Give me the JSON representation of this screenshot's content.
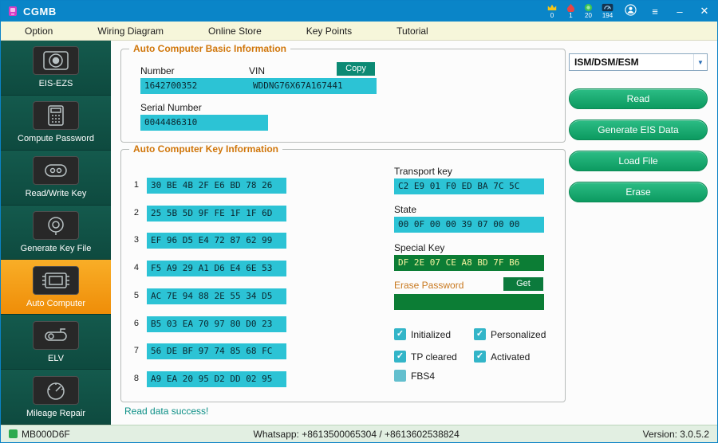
{
  "colors": {
    "titlebar_blue": "#0a85c8",
    "sidebar_green": "#0e4a3f",
    "selected_orange": "#f59b15",
    "field_cyan": "#2cc3d5",
    "dark_green_field": "#0c7d35",
    "action_button_green": "#0c9a60",
    "group_title_orange": "#d0760a"
  },
  "titlebar": {
    "app_name": "CGMB",
    "badges": [
      {
        "icon": "crown-icon",
        "count": "0"
      },
      {
        "icon": "drop-icon",
        "count": "1"
      },
      {
        "icon": "coin-icon",
        "count": "20"
      },
      {
        "icon": "meter-icon",
        "count": "194"
      }
    ]
  },
  "menubar": {
    "items": [
      {
        "label": "Option"
      },
      {
        "label": "Wiring Diagram"
      },
      {
        "label": "Online Store"
      },
      {
        "label": "Key Points"
      },
      {
        "label": "Tutorial"
      }
    ]
  },
  "sidebar": {
    "items": [
      {
        "label": "EIS-EZS",
        "selected": false
      },
      {
        "label": "Compute Password",
        "selected": false
      },
      {
        "label": "Read/Write Key",
        "selected": false
      },
      {
        "label": "Generate Key File",
        "selected": false
      },
      {
        "label": "Auto Computer",
        "selected": true
      },
      {
        "label": "ELV",
        "selected": false
      },
      {
        "label": "Mileage Repair",
        "selected": false
      }
    ]
  },
  "basic_info": {
    "title": "Auto Computer Basic Information",
    "number_label": "Number",
    "number_value": "1642700352",
    "vin_label": "VIN",
    "copy_button": "Copy",
    "vin_value": "WDDNG76X67A167441",
    "serial_label": "Serial Number",
    "serial_value": "0044486310"
  },
  "key_info": {
    "title": "Auto Computer Key Information",
    "rows": [
      {
        "index": "1",
        "value": "30 BE 4B 2F E6 BD 78 26"
      },
      {
        "index": "2",
        "value": "25 5B 5D 9F FE 1F 1F 6D"
      },
      {
        "index": "3",
        "value": "EF 96 D5 E4 72 87 62 99"
      },
      {
        "index": "4",
        "value": "F5 A9 29 A1 D6 E4 6E 53"
      },
      {
        "index": "5",
        "value": "AC 7E 94 88 2E 55 34 D5"
      },
      {
        "index": "6",
        "value": "B5 03 EA 70 97 80 D0 23"
      },
      {
        "index": "7",
        "value": "56 DE BF 97 74 85 68 FC"
      },
      {
        "index": "8",
        "value": "A9 EA 20 95 D2 DD 02 95"
      }
    ],
    "transport_key_label": "Transport key",
    "transport_key_value": "C2 E9 01 F0 ED BA 7C 5C",
    "state_label": "State",
    "state_value": "00 0F 00 00 39 07 00 00",
    "special_key_label": "Special Key",
    "special_key_value": "DF 2E 07 CE A8 BD 7F B6",
    "erase_password_label": "Erase Password",
    "get_button": "Get",
    "erase_password_value": "",
    "checkboxes": [
      {
        "label": "Initialized",
        "checked": true
      },
      {
        "label": "Personalized",
        "checked": true
      },
      {
        "label": "TP cleared",
        "checked": true
      },
      {
        "label": "Activated",
        "checked": true
      },
      {
        "label": "FBS4",
        "checked": false
      }
    ]
  },
  "status_message": "Read data success!",
  "right_panel": {
    "dropdown_value": "ISM/DSM/ESM",
    "buttons": [
      {
        "label": "Read"
      },
      {
        "label": "Generate EIS Data"
      },
      {
        "label": "Load File"
      },
      {
        "label": "Erase"
      }
    ]
  },
  "statusbar": {
    "device": "MB000D6F",
    "whatsapp": "Whatsapp: +8613500065304 / +8613602538824",
    "version": "Version: 3.0.5.2"
  }
}
